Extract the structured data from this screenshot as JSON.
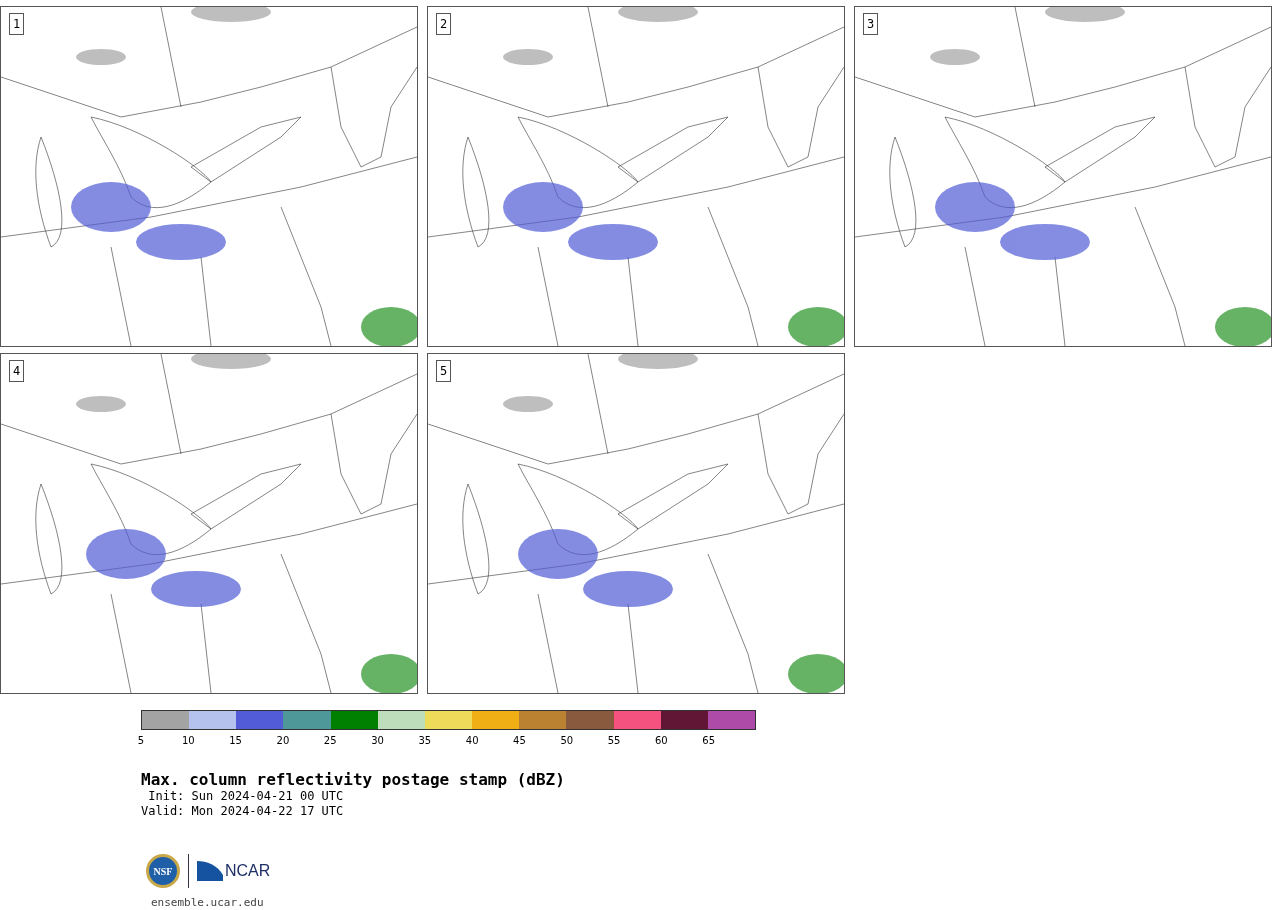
{
  "panels": [
    {
      "label": "1"
    },
    {
      "label": "2"
    },
    {
      "label": "3"
    },
    {
      "label": "4"
    },
    {
      "label": "5"
    }
  ],
  "colorbar": {
    "segments": [
      {
        "color": "#a3a3a3"
      },
      {
        "color": "#b6c2ee"
      },
      {
        "color": "#515cd6"
      },
      {
        "color": "#4f9899"
      },
      {
        "color": "#008000"
      },
      {
        "color": "#bedebb"
      },
      {
        "color": "#efdb5a"
      },
      {
        "color": "#efaf15"
      },
      {
        "color": "#ba8231"
      },
      {
        "color": "#8a5a3e"
      },
      {
        "color": "#f6527f"
      },
      {
        "color": "#621636"
      },
      {
        "color": "#ae4ba8"
      }
    ],
    "ticks": [
      "5",
      "10",
      "15",
      "20",
      "25",
      "30",
      "35",
      "40",
      "45",
      "50",
      "55",
      "60",
      "65"
    ]
  },
  "title": "Max. column reflectivity postage stamp (dBZ)",
  "init": " Init: Sun 2024-04-21 00 UTC",
  "valid": "Valid: Mon 2024-04-22 17 UTC",
  "logo": {
    "nsf": "NSF",
    "ncar": "NCAR"
  },
  "url": "ensemble.ucar.edu"
}
